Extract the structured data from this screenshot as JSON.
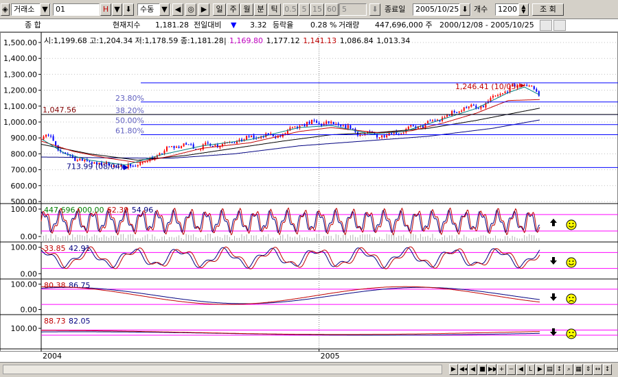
{
  "toolbar": {
    "market": "거래소",
    "code": "01",
    "period_h": "H",
    "mode": "수동",
    "periods": [
      "일",
      "주",
      "월",
      "분",
      "틱"
    ],
    "nums": [
      "0.5",
      "5",
      "15",
      "60",
      "5"
    ],
    "end_label": "종료일",
    "end_date": "2005/10/25",
    "count_label": "개수",
    "count": "1200",
    "query": "조 회"
  },
  "info": {
    "name": "종         합",
    "index_label": "현재지수",
    "index_value": "1,181.28",
    "change_label": "전일대비",
    "change_arrow": "▼",
    "change_value": "3.32",
    "rate_label": "등락율",
    "rate_value": "0.28 %",
    "volume_label": "거래량",
    "volume_value": "447,696,000 주",
    "range": "2000/12/08 - 2005/10/25"
  },
  "chart_data": {
    "type": "line",
    "main": {
      "ohlc_text": "시:1,199.68 고:1,204.34 저:1,178.59 종:1,181.28",
      "ma_values": [
        {
          "text": "1,169.80",
          "color": "#c000c0"
        },
        {
          "text": "1,177.12",
          "color": "#000000"
        },
        {
          "text": "1,141.13",
          "color": "#c00000"
        },
        {
          "text": "1,086.84",
          "color": "#000000"
        },
        {
          "text": "1,013.34",
          "color": "#000000"
        }
      ],
      "y_ticks": [
        "1,500.00",
        "1,400.00",
        "1,300.00",
        "1,200.00",
        "1,100.00",
        "1,000.00",
        "900.00",
        "800.00",
        "700.00",
        "600.00",
        "500.00"
      ],
      "ylim": [
        500,
        1500
      ],
      "level_1047": "1,047.56",
      "fib_labels": [
        "23.80%",
        "38.20%",
        "50.00%",
        "61.80%"
      ],
      "fib_values": [
        1126,
        1047,
        984,
        920
      ],
      "peak_label": "1,246.41 (10/05)",
      "peak_value": 1246.41,
      "trough_label": "713.99 (08/04)",
      "trough_value": 713.99,
      "close_anchors": [
        [
          0,
          905
        ],
        [
          6,
          915
        ],
        [
          12,
          900
        ],
        [
          17,
          870
        ],
        [
          22,
          810
        ],
        [
          30,
          795
        ],
        [
          40,
          780
        ],
        [
          50,
          760
        ],
        [
          60,
          748
        ],
        [
          72,
          740
        ],
        [
          82,
          730
        ],
        [
          92,
          725
        ],
        [
          100,
          720
        ],
        [
          105,
          714
        ],
        [
          110,
          722
        ],
        [
          120,
          735
        ],
        [
          135,
          762
        ],
        [
          150,
          810
        ],
        [
          160,
          835
        ],
        [
          170,
          855
        ],
        [
          180,
          850
        ],
        [
          190,
          845
        ],
        [
          200,
          848
        ],
        [
          220,
          862
        ],
        [
          240,
          880
        ],
        [
          260,
          900
        ],
        [
          280,
          910
        ],
        [
          300,
          920
        ],
        [
          310,
          950
        ],
        [
          320,
          975
        ],
        [
          330,
          985
        ],
        [
          340,
          1000
        ],
        [
          350,
          990
        ],
        [
          360,
          985
        ],
        [
          370,
          980
        ],
        [
          380,
          965
        ],
        [
          390,
          940
        ],
        [
          400,
          925
        ],
        [
          410,
          920
        ],
        [
          420,
          918
        ],
        [
          430,
          925
        ],
        [
          440,
          935
        ],
        [
          450,
          945
        ],
        [
          460,
          960
        ],
        [
          470,
          975
        ],
        [
          480,
          990
        ],
        [
          490,
          1010
        ],
        [
          500,
          1030
        ],
        [
          510,
          1050
        ],
        [
          520,
          1080
        ],
        [
          530,
          1100
        ],
        [
          540,
          1080
        ],
        [
          550,
          1110
        ],
        [
          560,
          1140
        ],
        [
          570,
          1180
        ],
        [
          580,
          1200
        ],
        [
          590,
          1230
        ],
        [
          600,
          1246
        ],
        [
          605,
          1225
        ],
        [
          610,
          1210
        ],
        [
          615,
          1185
        ],
        [
          619,
          1181
        ]
      ],
      "ma1_anchors": [
        [
          0,
          895
        ],
        [
          30,
          800
        ],
        [
          60,
          760
        ],
        [
          105,
          730
        ],
        [
          150,
          795
        ],
        [
          200,
          850
        ],
        [
          260,
          890
        ],
        [
          320,
          965
        ],
        [
          360,
          978
        ],
        [
          410,
          925
        ],
        [
          450,
          940
        ],
        [
          500,
          1020
        ],
        [
          540,
          1085
        ],
        [
          580,
          1185
        ],
        [
          600,
          1220
        ],
        [
          619,
          1170
        ]
      ],
      "ma2_anchors": [
        [
          0,
          880
        ],
        [
          40,
          815
        ],
        [
          80,
          775
        ],
        [
          120,
          745
        ],
        [
          160,
          785
        ],
        [
          200,
          835
        ],
        [
          260,
          870
        ],
        [
          320,
          940
        ],
        [
          360,
          965
        ],
        [
          420,
          932
        ],
        [
          460,
          945
        ],
        [
          500,
          995
        ],
        [
          540,
          1055
        ],
        [
          580,
          1135
        ],
        [
          619,
          1141
        ]
      ],
      "ma3_anchors": [
        [
          0,
          860
        ],
        [
          60,
          800
        ],
        [
          120,
          760
        ],
        [
          180,
          790
        ],
        [
          240,
          835
        ],
        [
          300,
          880
        ],
        [
          360,
          920
        ],
        [
          420,
          935
        ],
        [
          480,
          960
        ],
        [
          540,
          1010
        ],
        [
          619,
          1087
        ]
      ],
      "ma4_anchors": [
        [
          0,
          780
        ],
        [
          80,
          775
        ],
        [
          160,
          772
        ],
        [
          240,
          800
        ],
        [
          320,
          850
        ],
        [
          400,
          880
        ],
        [
          480,
          910
        ],
        [
          560,
          960
        ],
        [
          619,
          1013
        ]
      ]
    },
    "sub1": {
      "values_text": [
        {
          "text": "447,696,000.00",
          "color": "#008000"
        },
        {
          "text": "62.39",
          "color": "#c00000"
        },
        {
          "text": "54.96",
          "color": "#000080"
        }
      ],
      "y_ticks": [
        "100.00",
        "0.00"
      ],
      "ylim": [
        -20,
        120
      ],
      "signal": "up",
      "face": "smile"
    },
    "sub2": {
      "values_text": [
        {
          "text": "33.85",
          "color": "#c00000"
        },
        {
          "text": "42.91",
          "color": "#000080"
        }
      ],
      "y_ticks": [
        "100.00",
        "0.00"
      ],
      "ylim": [
        -20,
        120
      ],
      "signal": "down",
      "face": "smile"
    },
    "sub3": {
      "values_text": [
        {
          "text": "80.38",
          "color": "#c00000"
        },
        {
          "text": "86.75",
          "color": "#000080"
        }
      ],
      "y_ticks": [
        "100.00",
        "0.00"
      ],
      "ylim": [
        -20,
        120
      ],
      "signal": "down",
      "face": "frown"
    },
    "sub4": {
      "values_text": [
        {
          "text": "88.73",
          "color": "#c00000"
        },
        {
          "text": "82.05",
          "color": "#000080"
        }
      ],
      "y_ticks": [
        "100.00"
      ],
      "ylim": [
        40,
        140
      ],
      "signal": "down",
      "face": "frown"
    },
    "x_labels": [
      {
        "text": "2004",
        "index": 0
      },
      {
        "text": "2005",
        "index": 345
      }
    ],
    "n": 620
  },
  "colors": {
    "up": "#ff0000",
    "down": "#0000ff",
    "fib": "#0000ff",
    "magenta": "#ff00ff",
    "face": "#ffff00"
  }
}
